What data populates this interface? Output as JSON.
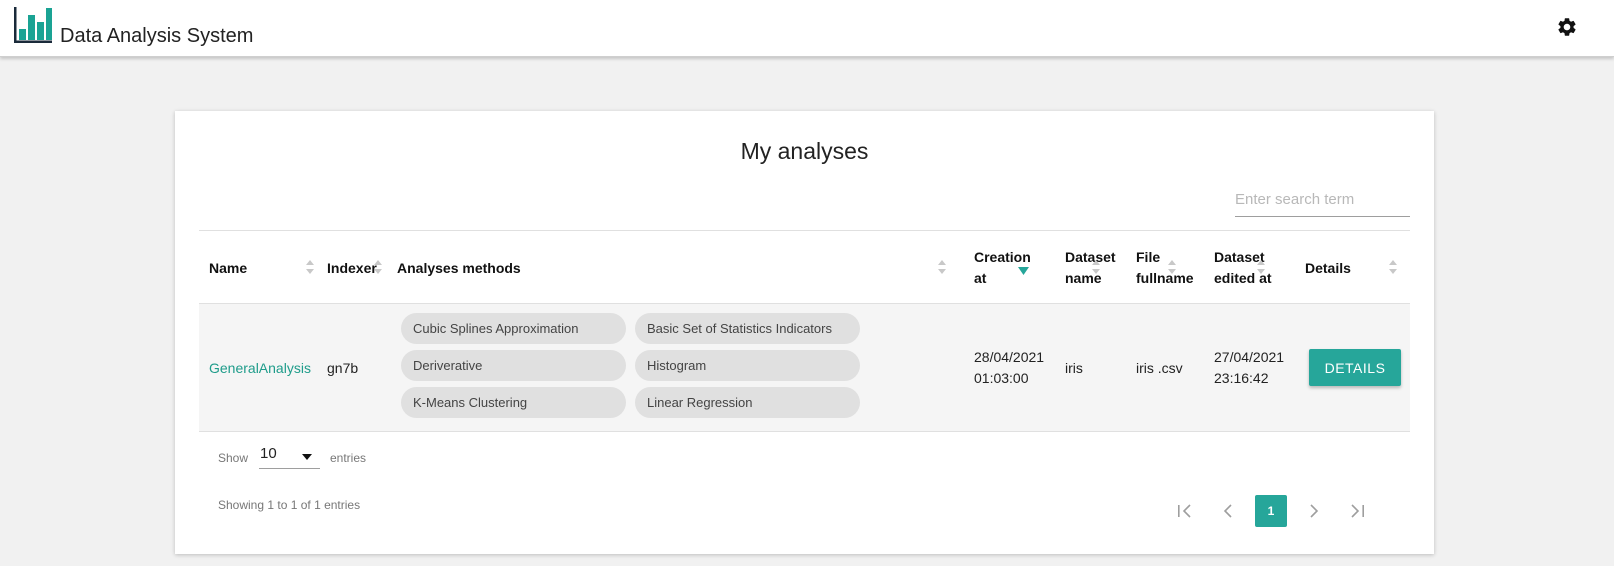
{
  "app": {
    "title": "Data Analysis System",
    "logo_icon": "bar-chart-icon",
    "settings_icon": "gear-icon"
  },
  "colors": {
    "accent": "#26a69a",
    "link": "#1e9c8a",
    "logo": "#1aa394"
  },
  "main": {
    "title": "My analyses",
    "search_placeholder": "Enter search term",
    "columns": [
      "Name",
      "Indexer",
      "Analyses methods",
      "Creation at",
      "Dataset name",
      "File fullname",
      "Dataset edited at",
      "Details"
    ],
    "column_lines": {
      "creation": [
        "Creation",
        "at"
      ],
      "dataset_name": [
        "Dataset",
        "name"
      ],
      "file_fullname": [
        "File",
        "fullname"
      ],
      "dataset_edited": [
        "Dataset",
        "edited at"
      ]
    },
    "sorted_column": "Creation at",
    "rows": [
      {
        "name": "GeneralAnalysis",
        "indexer": "gn7b",
        "methods": [
          "Cubic Splines Approximation",
          "Basic Set of Statistics Indicators",
          "Deriverative",
          "Histogram",
          "K-Means Clustering",
          "Linear Regression"
        ],
        "creation_date": "28/04/2021",
        "creation_time": "01:03:00",
        "dataset_name": "iris",
        "file_fullname": "iris .csv",
        "edited_date": "27/04/2021",
        "edited_time": "23:16:42",
        "details_label": "DETAILS"
      }
    ],
    "length_menu": {
      "show_label": "Show",
      "value": "10",
      "entries_label": "entries"
    },
    "info": "Showing 1 to 1 of 1 entries",
    "pagination": {
      "current_page": "1",
      "first_icon": "first-page-icon",
      "prev_icon": "chevron-left-icon",
      "next_icon": "chevron-right-icon",
      "last_icon": "last-page-icon"
    }
  }
}
